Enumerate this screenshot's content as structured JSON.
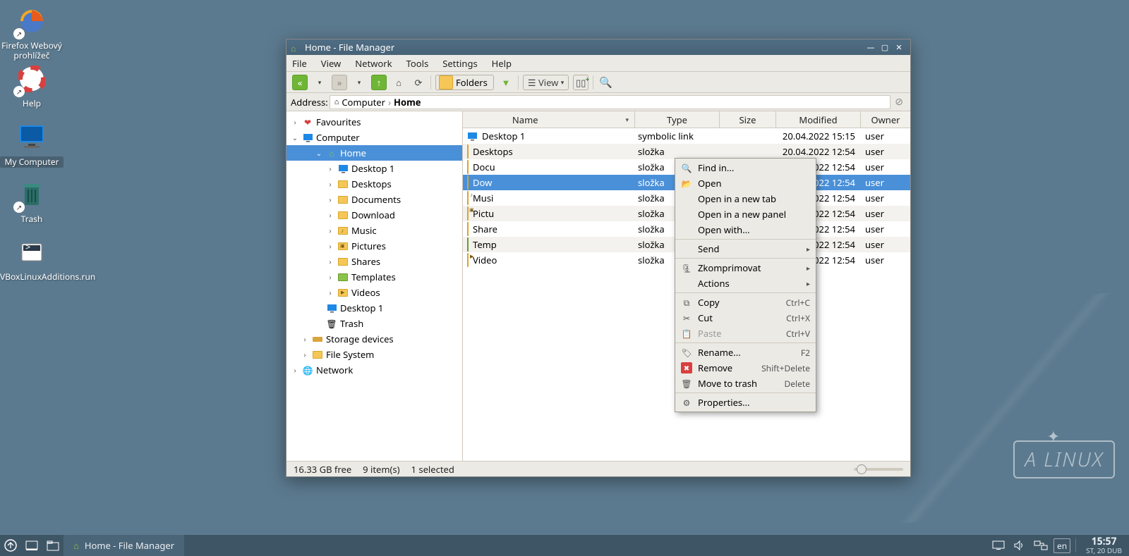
{
  "desktop_icons": [
    {
      "id": "firefox",
      "label": "Firefox Webový\nprohlížeč"
    },
    {
      "id": "help",
      "label": "Help"
    },
    {
      "id": "mycomputer",
      "label": "My Computer"
    },
    {
      "id": "trash",
      "label": "Trash"
    },
    {
      "id": "vbox",
      "label": "VBoxLinuxAdditions.run"
    }
  ],
  "watermark": "A LINUX",
  "window": {
    "title": "Home - File Manager",
    "menu": [
      "File",
      "View",
      "Network",
      "Tools",
      "Settings",
      "Help"
    ],
    "toolbar": {
      "folders_label": "Folders",
      "view_label": "View"
    },
    "address": {
      "label": "Address:",
      "crumbs": [
        "Computer",
        "Home"
      ]
    },
    "tree": [
      {
        "indent": 0,
        "label": "Favourites",
        "icon": "heart",
        "exp": "›"
      },
      {
        "indent": 0,
        "label": "Computer",
        "icon": "monitor",
        "exp": "⌄"
      },
      {
        "indent": 2,
        "label": "Home",
        "icon": "house",
        "exp": "⌄",
        "sel": true
      },
      {
        "indent": 3,
        "label": "Desktop 1",
        "icon": "monitor",
        "exp": "›"
      },
      {
        "indent": 3,
        "label": "Desktops",
        "icon": "folder",
        "exp": "›"
      },
      {
        "indent": 3,
        "label": "Documents",
        "icon": "folder",
        "exp": "›"
      },
      {
        "indent": 3,
        "label": "Download",
        "icon": "folder",
        "exp": "›"
      },
      {
        "indent": 3,
        "label": "Music",
        "icon": "music",
        "exp": "›"
      },
      {
        "indent": 3,
        "label": "Pictures",
        "icon": "pictures",
        "exp": "›"
      },
      {
        "indent": 3,
        "label": "Shares",
        "icon": "folder",
        "exp": "›"
      },
      {
        "indent": 3,
        "label": "Templates",
        "icon": "folder-g",
        "exp": "›"
      },
      {
        "indent": 3,
        "label": "Videos",
        "icon": "videos",
        "exp": "›"
      },
      {
        "indent": 2,
        "label": "Desktop 1",
        "icon": "monitor",
        "exp": ""
      },
      {
        "indent": 2,
        "label": "Trash",
        "icon": "trash",
        "exp": ""
      },
      {
        "indent": 1,
        "label": "Storage devices",
        "icon": "drive",
        "exp": "›"
      },
      {
        "indent": 1,
        "label": "File System",
        "icon": "folder",
        "exp": "›"
      },
      {
        "indent": 0,
        "label": "Network",
        "icon": "network",
        "exp": "›"
      }
    ],
    "columns": {
      "name": "Name",
      "type": "Type",
      "size": "Size",
      "modified": "Modified",
      "owner": "Owner"
    },
    "rows": [
      {
        "name": "Desktop 1",
        "icon": "monitor",
        "type": "symbolic link",
        "size": "",
        "modified": "20.04.2022 15:15",
        "owner": "user"
      },
      {
        "name": "Desktops",
        "icon": "folder",
        "type": "složka",
        "size": "",
        "modified": "20.04.2022 12:54",
        "owner": "user"
      },
      {
        "name": "Docu",
        "icon": "folder",
        "type": "složka",
        "size": "",
        "modified": "20.04.2022 12:54",
        "owner": "user"
      },
      {
        "name": "Dow",
        "icon": "folder",
        "type": "složka",
        "size": "",
        "modified": "20.04.2022 12:54",
        "owner": "user",
        "sel": true
      },
      {
        "name": "Musi",
        "icon": "music",
        "type": "složka",
        "size": "",
        "modified": "20.04.2022 12:54",
        "owner": "user"
      },
      {
        "name": "Pictu",
        "icon": "pictures",
        "type": "složka",
        "size": "",
        "modified": "20.04.2022 12:54",
        "owner": "user"
      },
      {
        "name": "Share",
        "icon": "folder",
        "type": "složka",
        "size": "",
        "modified": "20.04.2022 12:54",
        "owner": "user"
      },
      {
        "name": "Temp",
        "icon": "folder-g",
        "type": "složka",
        "size": "",
        "modified": "20.04.2022 12:54",
        "owner": "user"
      },
      {
        "name": "Video",
        "icon": "videos",
        "type": "složka",
        "size": "",
        "modified": "20.04.2022 12:54",
        "owner": "user"
      }
    ],
    "context": [
      {
        "kind": "item",
        "label": "Find in...",
        "icon": "search"
      },
      {
        "kind": "item",
        "label": "Open",
        "icon": "folderopen"
      },
      {
        "kind": "item",
        "label": "Open in a new tab"
      },
      {
        "kind": "item",
        "label": "Open in a new panel"
      },
      {
        "kind": "item",
        "label": "Open with..."
      },
      {
        "kind": "sep"
      },
      {
        "kind": "item",
        "label": "Send",
        "sub": true
      },
      {
        "kind": "sep"
      },
      {
        "kind": "item",
        "label": "Zkomprimovat",
        "icon": "archive",
        "sub": true
      },
      {
        "kind": "item",
        "label": "Actions",
        "sub": true
      },
      {
        "kind": "sep"
      },
      {
        "kind": "item",
        "label": "Copy",
        "icon": "copy",
        "shortcut": "Ctrl+C"
      },
      {
        "kind": "item",
        "label": "Cut",
        "icon": "cut",
        "shortcut": "Ctrl+X"
      },
      {
        "kind": "item",
        "label": "Paste",
        "icon": "paste",
        "shortcut": "Ctrl+V",
        "disabled": true
      },
      {
        "kind": "sep"
      },
      {
        "kind": "item",
        "label": "Rename...",
        "icon": "rename",
        "shortcut": "F2"
      },
      {
        "kind": "item",
        "label": "Remove",
        "icon": "remove",
        "shortcut": "Shift+Delete"
      },
      {
        "kind": "item",
        "label": "Move to trash",
        "icon": "trash",
        "shortcut": "Delete"
      },
      {
        "kind": "sep"
      },
      {
        "kind": "item",
        "label": "Properties...",
        "icon": "props"
      }
    ],
    "status": {
      "free": "16.33 GB free",
      "items": "9 item(s)",
      "selected": "1 selected"
    }
  },
  "taskbar": {
    "task": "Home - File Manager",
    "lang": "en",
    "time": "15:57",
    "date": "ST, 20 DUB"
  }
}
